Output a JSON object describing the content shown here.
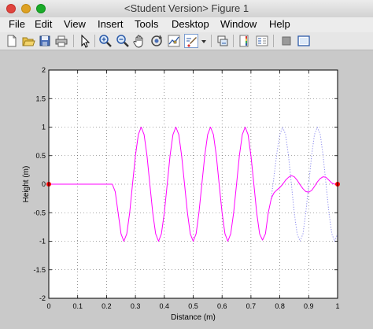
{
  "window": {
    "title": "<Student Version> Figure 1"
  },
  "menu": {
    "items": [
      "File",
      "Edit",
      "View",
      "Insert",
      "Tools",
      "Desktop",
      "Window",
      "Help"
    ]
  },
  "toolbar": {
    "icons": [
      "new-figure-icon",
      "open-file-icon",
      "save-icon",
      "print-icon",
      "edit-plot-arrow-icon",
      "zoom-in-icon",
      "zoom-out-icon",
      "pan-hand-icon",
      "rotate-3d-icon",
      "data-cursor-icon",
      "brush-icon",
      "brush-dropdown-icon",
      "link-plot-icon",
      "insert-colorbar-icon",
      "insert-legend-icon",
      "hide-plot-tools-icon",
      "show-plot-tools-icon"
    ]
  },
  "colors": {
    "wave": "#ff00ff",
    "dotted_wave": "#8888ee",
    "marker": "#ff0000"
  },
  "chart_data": {
    "type": "line",
    "xlabel": "Distance (m)",
    "ylabel": "Height (m)",
    "xlim": [
      0,
      1
    ],
    "ylim": [
      -2,
      2
    ],
    "xticks": [
      "0",
      "0.1",
      "0.2",
      "0.3",
      "0.4",
      "0.5",
      "0.6",
      "0.7",
      "0.8",
      "0.9",
      "1"
    ],
    "yticks": [
      "-2",
      "-1.5",
      "-1",
      "-0.5",
      "0",
      "0.5",
      "1",
      "1.5",
      "2"
    ],
    "grid": true,
    "series": [
      {
        "style": "solid magenta",
        "x": [
          0,
          0.22,
          0.23,
          0.24,
          0.25,
          0.26,
          0.27,
          0.28,
          0.29,
          0.3,
          0.31,
          0.32,
          0.33,
          0.34,
          0.35,
          0.36,
          0.37,
          0.38,
          0.39,
          0.4,
          0.41,
          0.42,
          0.43,
          0.44,
          0.45,
          0.46,
          0.47,
          0.48,
          0.49,
          0.5,
          0.51,
          0.52,
          0.53,
          0.54,
          0.55,
          0.56,
          0.57,
          0.58,
          0.59,
          0.6,
          0.61,
          0.62,
          0.63,
          0.64,
          0.65,
          0.66,
          0.67,
          0.68,
          0.69,
          0.7,
          0.71,
          0.72,
          0.73,
          0.74,
          0.75,
          0.76,
          0.77,
          0.775,
          0.78,
          0.79,
          0.8,
          0.81,
          0.82,
          0.83,
          0.84,
          0.85,
          0.86,
          0.87,
          0.88,
          0.89,
          0.9,
          0.91,
          0.92,
          0.93,
          0.94,
          0.95,
          0.96,
          0.97,
          0.98,
          0.99,
          1.0
        ],
        "y": [
          0,
          0,
          -0.13,
          -0.5,
          -0.87,
          -1.0,
          -0.87,
          -0.5,
          0,
          0.5,
          0.87,
          1.0,
          0.87,
          0.5,
          0,
          -0.5,
          -0.87,
          -1.0,
          -0.87,
          -0.5,
          0,
          0.5,
          0.87,
          1.0,
          0.87,
          0.5,
          0,
          -0.5,
          -0.87,
          -1.0,
          -0.87,
          -0.5,
          0,
          0.5,
          0.87,
          1.0,
          0.87,
          0.5,
          0,
          -0.5,
          -0.87,
          -1.0,
          -0.87,
          -0.5,
          0,
          0.5,
          0.87,
          1.0,
          0.87,
          0.5,
          0,
          -0.5,
          -0.87,
          -0.98,
          -0.87,
          -0.5,
          -0.26,
          -0.2,
          -0.15,
          -0.1,
          -0.06,
          0.0,
          0.07,
          0.12,
          0.15,
          0.13,
          0.07,
          -0.01,
          -0.08,
          -0.13,
          -0.14,
          -0.11,
          -0.04,
          0.04,
          0.1,
          0.13,
          0.12,
          0.07,
          0.02,
          0.0,
          0.0
        ]
      },
      {
        "style": "dotted blue",
        "x": [
          0.77,
          0.78,
          0.79,
          0.8,
          0.81,
          0.82,
          0.83,
          0.84,
          0.85,
          0.86,
          0.87,
          0.88,
          0.89,
          0.9,
          0.91,
          0.92,
          0.93,
          0.94,
          0.95,
          0.96,
          0.97,
          0.98,
          0.99,
          1.0
        ],
        "y": [
          -0.26,
          0.15,
          0.55,
          0.87,
          1.0,
          0.87,
          0.5,
          0.0,
          -0.5,
          -0.87,
          -1.0,
          -0.87,
          -0.5,
          0.0,
          0.5,
          0.87,
          1.0,
          0.87,
          0.5,
          0.0,
          -0.5,
          -0.87,
          -1.0,
          -0.87
        ]
      }
    ],
    "markers": [
      {
        "x": 0,
        "y": 0
      },
      {
        "x": 1,
        "y": 0
      }
    ]
  }
}
